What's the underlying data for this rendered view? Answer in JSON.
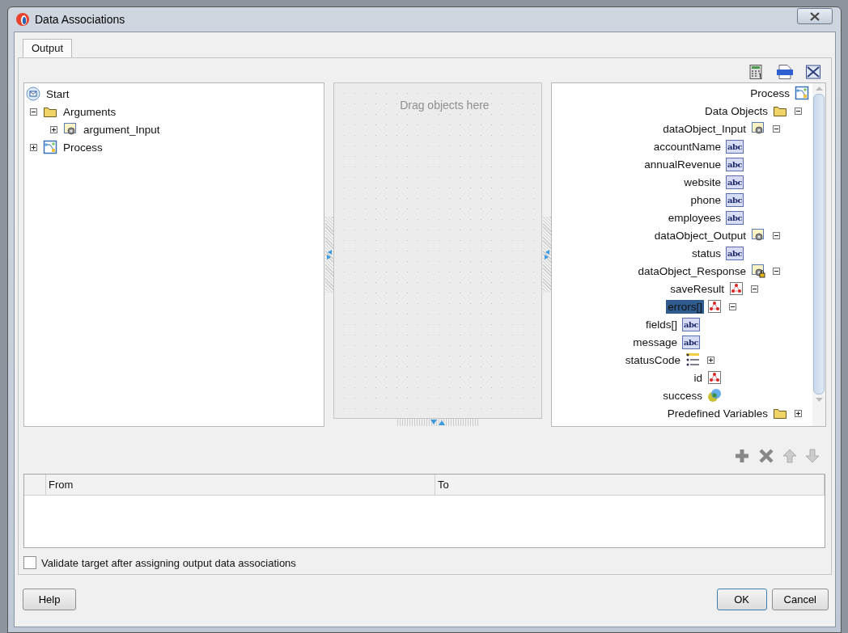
{
  "window": {
    "title": "Data Associations"
  },
  "tabs": [
    {
      "label": "Output",
      "selected": true
    }
  ],
  "left_tree": [
    {
      "label": "Start",
      "kind": "start",
      "selected": false
    },
    {
      "label": "Arguments",
      "kind": "folder",
      "expanded": true,
      "selected": false,
      "children": [
        {
          "label": "argument_Input",
          "kind": "object",
          "expanded": false,
          "selected": false
        }
      ]
    },
    {
      "label": "Process",
      "kind": "process",
      "expanded": false,
      "selected": false
    }
  ],
  "drop_area": {
    "placeholder": "Drag objects here"
  },
  "right_tree": [
    {
      "label": "Process",
      "kind": "process",
      "selected": false,
      "children": [
        {
          "label": "Data Objects",
          "kind": "folder",
          "expanded": true,
          "selected": false,
          "children": [
            {
              "label": "dataObject_Input",
              "kind": "object",
              "expanded": true,
              "selected": false,
              "children": [
                {
                  "label": "accountName",
                  "kind": "string",
                  "badge": "abc",
                  "selected": false
                },
                {
                  "label": "annualRevenue",
                  "kind": "string",
                  "badge": "abc",
                  "selected": false
                },
                {
                  "label": "website",
                  "kind": "string",
                  "badge": "abc",
                  "selected": false
                },
                {
                  "label": "phone",
                  "kind": "string",
                  "badge": "abc",
                  "selected": false
                },
                {
                  "label": "employees",
                  "kind": "string",
                  "badge": "abc",
                  "selected": false
                }
              ]
            },
            {
              "label": "dataObject_Output",
              "kind": "object",
              "expanded": true,
              "selected": false,
              "children": [
                {
                  "label": "status",
                  "kind": "string",
                  "badge": "abc",
                  "selected": false
                }
              ]
            },
            {
              "label": "dataObject_Response",
              "kind": "locked-object",
              "expanded": true,
              "selected": false,
              "children": [
                {
                  "label": "saveResult",
                  "kind": "element",
                  "expanded": true,
                  "selected": false,
                  "children": [
                    {
                      "label": "errors[]",
                      "kind": "element",
                      "expanded": true,
                      "selected": true,
                      "children": [
                        {
                          "label": "fields[]",
                          "kind": "string",
                          "badge": "abc",
                          "selected": false
                        },
                        {
                          "label": "message",
                          "kind": "string",
                          "badge": "abc",
                          "selected": false
                        },
                        {
                          "label": "statusCode",
                          "kind": "list",
                          "expanded": false,
                          "selected": false
                        }
                      ]
                    },
                    {
                      "label": "id",
                      "kind": "element",
                      "selected": false
                    },
                    {
                      "label": "success",
                      "kind": "boolean",
                      "selected": false
                    }
                  ]
                }
              ]
            }
          ]
        },
        {
          "label": "Predefined Variables",
          "kind": "folder",
          "expanded": false,
          "selected": false
        }
      ]
    }
  ],
  "table": {
    "columns": [
      "From",
      "To"
    ]
  },
  "validate_checkbox": {
    "label": "Validate target after assigning output data associations",
    "checked": false
  },
  "buttons": [
    {
      "label": "Help",
      "kind": "help"
    },
    {
      "label": "OK",
      "kind": "default"
    },
    {
      "label": "Cancel",
      "kind": "cancel"
    }
  ]
}
